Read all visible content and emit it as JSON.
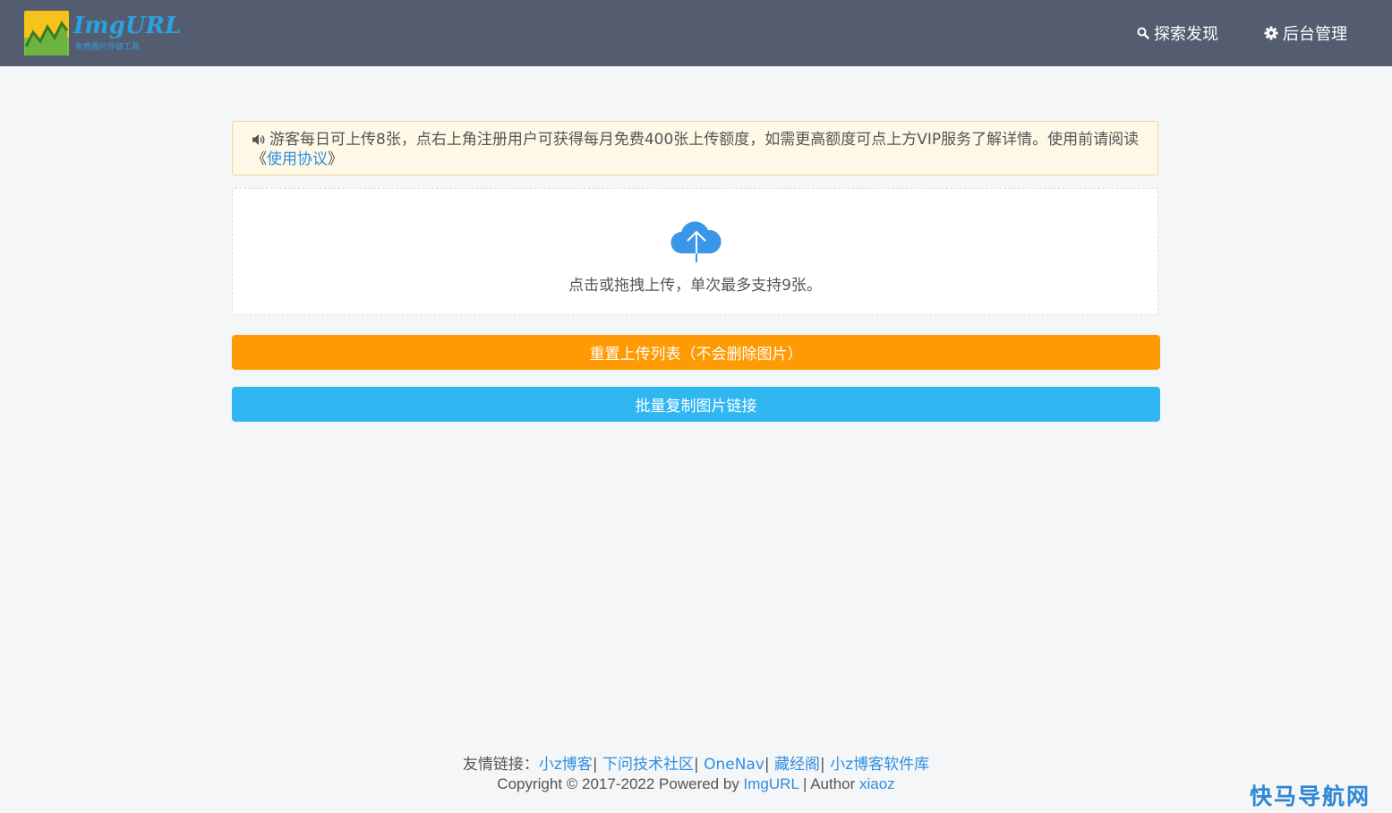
{
  "brand": {
    "name": "ImgURL",
    "tagline": "免费图片外链工具"
  },
  "nav": {
    "explore_label": "探索发现",
    "admin_label": "后台管理"
  },
  "notice": {
    "text": "游客每日可上传8张，点右上角注册用户可获得每月免费400张上传额度，如需更高额度可点上方VIP服务了解详情。使用前请阅读《",
    "link_label": "使用协议",
    "text_end": "》"
  },
  "upload": {
    "hint": "点击或拖拽上传，单次最多支持9张。"
  },
  "buttons": {
    "reset_label": "重置上传列表（不会删除图片）",
    "copy_label": "批量复制图片链接"
  },
  "footer": {
    "links_prefix": "友情链接：",
    "links": [
      "小z博客",
      "下问技术社区",
      "OneNav",
      "藏经阁",
      "小z博客软件库"
    ],
    "separator": "| ",
    "copyright_prefix": "Copyright © 2017-2022 Powered by ",
    "powered_link": "ImgURL",
    "author_prefix": " | Author ",
    "author_link": "xiaoz"
  },
  "watermark": "快马导航网",
  "colors": {
    "header_bg": "#545c70",
    "reset_button": "#fe9a03",
    "copy_button": "#30b7f2",
    "link": "#2f8ee0",
    "notice_bg": "#fef8e6"
  },
  "icons": {
    "explore": "search-icon",
    "admin": "gear-icon",
    "notice": "speaker-icon",
    "upload": "cloud-upload-icon"
  }
}
